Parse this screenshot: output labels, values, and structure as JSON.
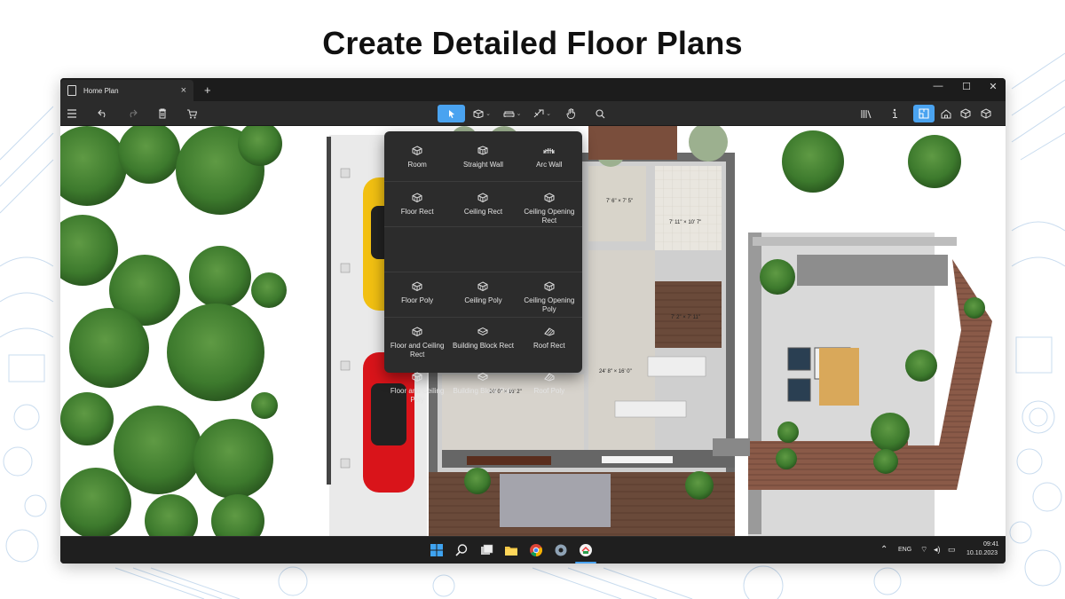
{
  "headline": "Create Detailed Floor Plans",
  "window": {
    "tab_title": "Home Plan",
    "tab_close": "×",
    "new_tab": "+",
    "minimize": "—",
    "maximize": "☐",
    "close": "✕"
  },
  "toolbar": {
    "left": [
      "menu-icon",
      "undo-icon",
      "redo-icon",
      "delete-icon",
      "cart-icon"
    ],
    "center": [
      "select-icon",
      "construction-icon",
      "furniture-icon",
      "measure-icon",
      "pan-icon",
      "zoom-icon"
    ],
    "right": [
      "library-icon",
      "info-icon",
      "2d-plan-icon",
      "3d-house-icon",
      "3d-view-icon",
      "3d-object-icon"
    ]
  },
  "menu": {
    "items": [
      {
        "label": "Room",
        "icon": "room-icon"
      },
      {
        "label": "Straight Wall",
        "icon": "straight-wall-icon"
      },
      {
        "label": "Arc Wall",
        "icon": "arc-wall-icon"
      },
      {
        "label": "Floor Rect",
        "icon": "floor-rect-icon"
      },
      {
        "label": "Ceiling Rect",
        "icon": "ceiling-rect-icon"
      },
      {
        "label": "Ceiling Opening Rect",
        "icon": "ceiling-opening-rect-icon"
      },
      {
        "label": "Floor Poly",
        "icon": "floor-poly-icon"
      },
      {
        "label": "Ceiling Poly",
        "icon": "ceiling-poly-icon"
      },
      {
        "label": "Ceiling Opening Poly",
        "icon": "ceiling-opening-poly-icon"
      },
      {
        "label": "Floor and Ceiling Rect",
        "icon": "floor-ceiling-rect-icon"
      },
      {
        "label": "Building Block Rect",
        "icon": "building-block-rect-icon"
      },
      {
        "label": "Roof Rect",
        "icon": "roof-rect-icon"
      },
      {
        "label": "Floor and Ceiling Poly",
        "icon": "floor-ceiling-poly-icon"
      },
      {
        "label": "Building Block Poly",
        "icon": "building-block-poly-icon"
      },
      {
        "label": "Roof Poly",
        "icon": "roof-poly-icon"
      }
    ]
  },
  "plan": {
    "dimensions": [
      "7' 6\" × 7' 5\"",
      "7' 11\" × 10' 7\"",
      "7' 2\" × 7' 11\"",
      "24' 8\" × 16' 0\"",
      "20' 0\" × 16' 2\""
    ]
  },
  "taskbar": {
    "apps": [
      "windows-start-icon",
      "search-icon",
      "task-view-icon",
      "file-explorer-icon",
      "chrome-icon",
      "settings-icon",
      "home-planner-app-icon"
    ],
    "language": "ENG",
    "time": "09:41",
    "date": "10.10.2023"
  },
  "colors": {
    "accent": "#4aa3f0",
    "window_bg": "#202020",
    "toolbar_bg": "#2b2b2b",
    "menu_bg": "#2c2c2c"
  }
}
